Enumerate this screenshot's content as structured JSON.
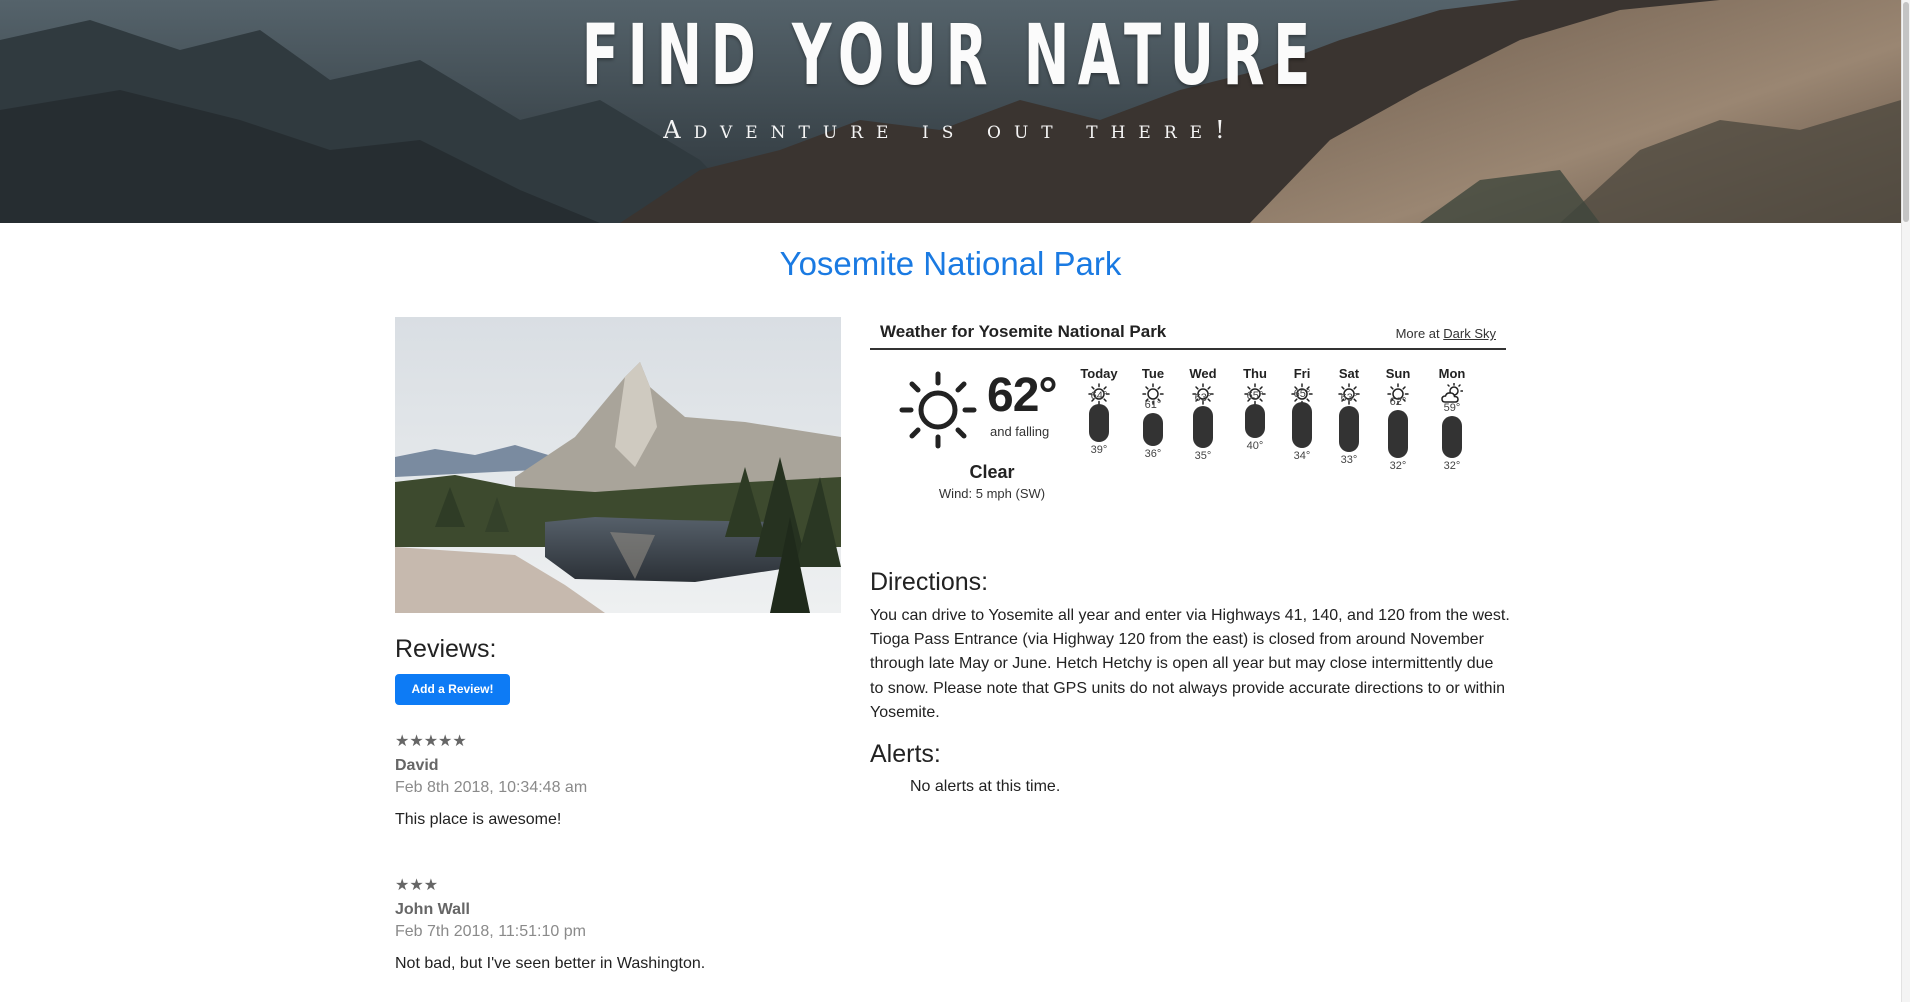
{
  "hero": {
    "title": "FIND YOUR NATURE",
    "subtitle": "Adventure is out there!"
  },
  "park": {
    "name": "Yosemite National Park"
  },
  "reviews": {
    "heading": "Reviews:",
    "add_button": "Add a Review!",
    "items": [
      {
        "stars": "★★★★★",
        "author": "David",
        "date": "Feb 8th 2018, 10:34:48 am",
        "text": "This place is awesome!"
      },
      {
        "stars": "★★★",
        "author": "John Wall",
        "date": "Feb 7th 2018, 11:51:10 pm",
        "text": "Not bad, but I've seen better in Washington."
      }
    ]
  },
  "weather": {
    "title": "Weather for Yosemite National Park",
    "more_prefix": "More at ",
    "more_link": "Dark Sky",
    "current": {
      "temp": "62°",
      "trend": "and falling",
      "summary": "Clear",
      "wind": "Wind: 5 mph (SW)",
      "icon": "sun-icon"
    },
    "days": [
      {
        "name": "Today",
        "icon": "sun-icon",
        "high": "64°",
        "low": "39°"
      },
      {
        "name": "Tue",
        "icon": "sun-icon",
        "high": "61°",
        "low": "36°"
      },
      {
        "name": "Wed",
        "icon": "sun-icon",
        "high": "63°",
        "low": "35°"
      },
      {
        "name": "Thu",
        "icon": "sun-icon",
        "high": "65°",
        "low": "40°"
      },
      {
        "name": "Fri",
        "icon": "sun-icon",
        "high": "65°",
        "low": "34°"
      },
      {
        "name": "Sat",
        "icon": "sun-icon",
        "high": "63°",
        "low": "33°"
      },
      {
        "name": "Sun",
        "icon": "sun-icon",
        "high": "62°",
        "low": "32°"
      },
      {
        "name": "Mon",
        "icon": "partly-cloudy-icon",
        "high": "59°",
        "low": "32°"
      }
    ]
  },
  "directions": {
    "heading": "Directions:",
    "text": "You can drive to Yosemite all year and enter via Highways 41, 140, and 120 from the west. Tioga Pass Entrance (via Highway 120 from the east) is closed from around November through late May or June. Hetch Hetchy is open all year but may close intermittently due to snow. Please note that GPS units do not always provide accurate directions to or within Yosemite."
  },
  "alerts": {
    "heading": "Alerts:",
    "text": "No alerts at this time."
  }
}
